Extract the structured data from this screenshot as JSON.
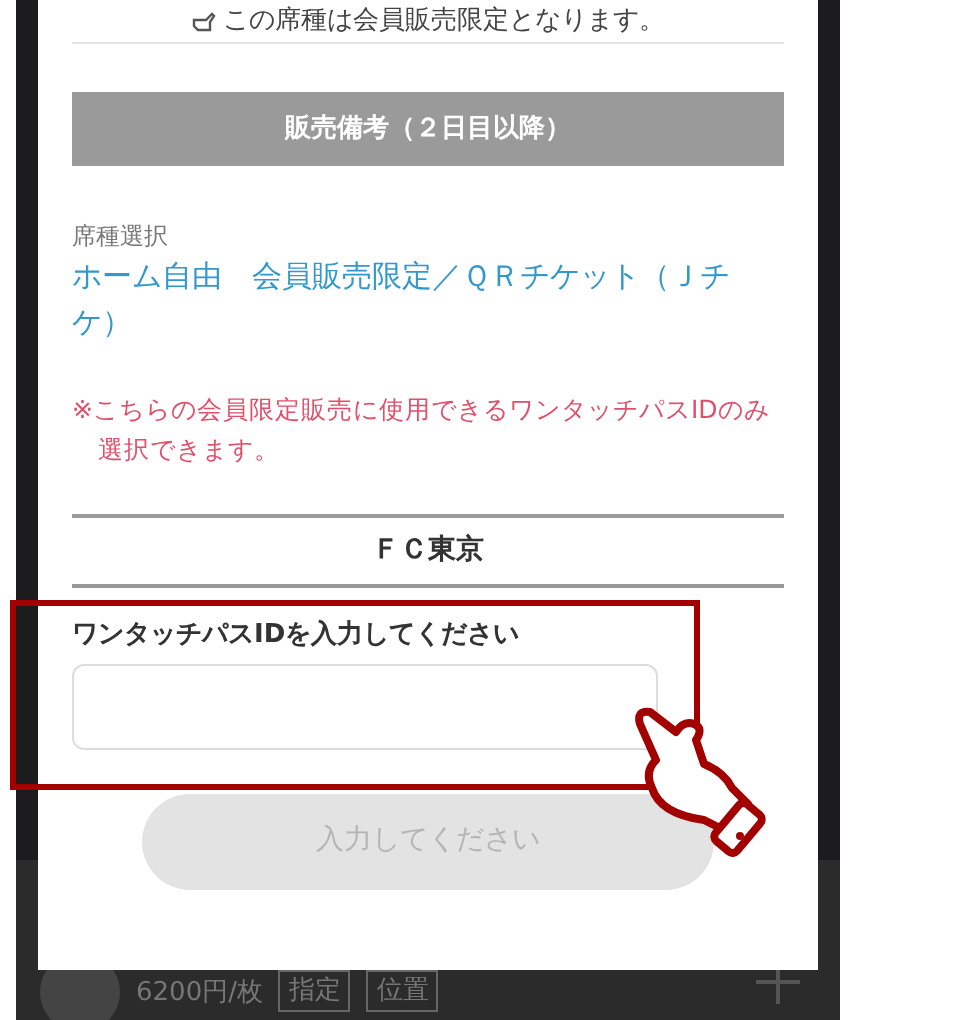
{
  "notice": "この席種は会員販売限定となります。",
  "section_header": "販売備考（２日目以降）",
  "seat": {
    "label": "席種選択",
    "name": "ホーム自由　会員販売限定／ＱＲチケット（Ｊチケ）"
  },
  "note": "※こちらの会員限定販売に使用できるワンタッチパスIDのみ選択できます。",
  "team": "ＦＣ東京",
  "id_field": {
    "label": "ワンタッチパスIDを入力してください"
  },
  "submit": {
    "label": "入力してください",
    "disabled": true
  },
  "background_row": {
    "price": "6200円/枚",
    "tags": [
      "指定",
      "位置"
    ]
  }
}
